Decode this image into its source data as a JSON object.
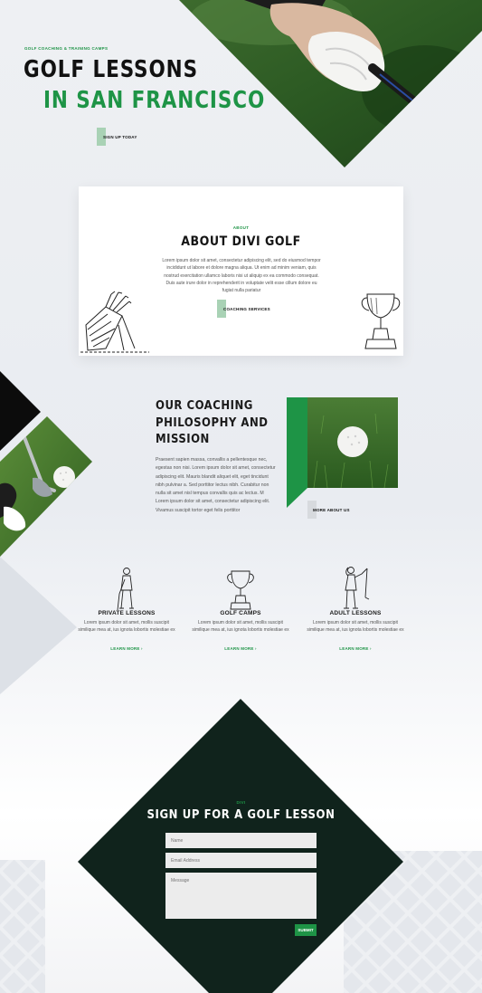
{
  "colors": {
    "accent": "#1e9446",
    "dark": "#10231c",
    "text": "#151515"
  },
  "hero": {
    "eyebrow": "GOLF COACHING & TRAINING CAMPS",
    "title_line1": "GOLF LESSONS",
    "title_line2": "IN SAN FRANCISCO",
    "cta": "SIGN UP TODAY",
    "photo_icon": "golf-glove-grip-photo"
  },
  "about": {
    "eyebrow": "ABOUT",
    "title": "ABOUT DIVI GOLF",
    "body": "Lorem ipsum dolor sit amet, consectetur adipiscing elit, sed do eiusmod tempor incididunt ut labore et dolore magna aliqua. Ut enim ad minim veniam, quis nostrud exercitation ullamco laboris nisi ut aliquip ex ea commodo consequat. Duis aute irure dolor in reprehenderit in voluptate velit esse cillum dolore eu fugiat nulla pariatur",
    "cta": "COACHING SERVICES",
    "left_icon": "golf-bag-sketch",
    "right_icon": "trophy-sketch"
  },
  "philosophy": {
    "title": "OUR COACHING PHILOSOPHY AND MISSION",
    "body": "Praesent sapien massa, convallis a pellentesque nec, egestas non nisi. Lorem ipsum dolor sit amet, consectetur adipiscing elit. Mauris blandit aliquet elit, eget tincidunt nibh pulvinar a. Sed porttitor lectus nibh. Curabitur non nulla sit amet nisl tempus convallis quis ac lectus. M Lorem ipsum dolor sit amet, consectetur adipiscing elit. Vivamus suscipit tortor eget felis porttitor",
    "cta": "MORE ABOUT US"
  },
  "services": [
    {
      "title": "PRIVATE LESSONS",
      "desc": "Lorem ipsum dolor sit amet, mollis suscipit similique mea at, ius ignota lobortis molestiae ex",
      "link": "LEARN MORE",
      "icon": "golfer-sketch"
    },
    {
      "title": "GOLF CAMPS",
      "desc": "Lorem ipsum dolor sit amet, mollis suscipit similique mea at, ius ignota lobortis molestiae ex",
      "link": "LEARN MORE",
      "icon": "trophy-sketch"
    },
    {
      "title": "ADULT LESSONS",
      "desc": "Lorem ipsum dolor sit amet, mollis suscipit similique mea at, ius ignota lobortis molestiae ex",
      "link": "LEARN MORE",
      "icon": "woman-golfer-sketch"
    }
  ],
  "signup": {
    "eyebrow": "DIVI",
    "title": "SIGN UP FOR A GOLF LESSON",
    "name_placeholder": "Name",
    "email_placeholder": "Email Address",
    "message_placeholder": "Message",
    "submit": "SUBMIT"
  }
}
